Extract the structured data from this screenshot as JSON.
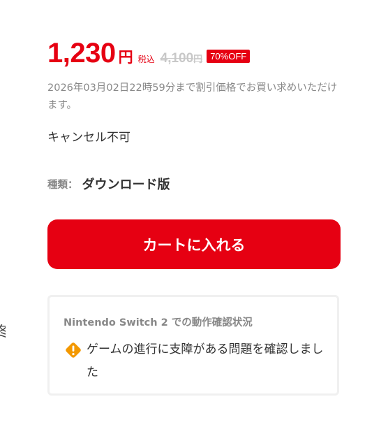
{
  "price": {
    "amount": "1,230",
    "currency": "円",
    "tax_label": "税込",
    "original_amount": "4,100",
    "original_currency": "円",
    "discount_badge": "70%OFF"
  },
  "sale_note": "2026年03月02日22時59分まで割引価格でお買い求めいただけます。",
  "cancel_note": "キャンセル不可",
  "type": {
    "label": "種類：",
    "value": "ダウンロード版"
  },
  "cart_button_label": "カートに入れる",
  "compatibility": {
    "title": "Nintendo Switch 2 での動作確認状況",
    "status_icon": "warning-diamond-icon",
    "status_text": "ゲームの進行に支障がある問題を確認しました"
  },
  "colors": {
    "accent": "#e60012",
    "warning": "#f39800",
    "muted_text": "#888888",
    "strikethrough": "#c8c8c8"
  }
}
